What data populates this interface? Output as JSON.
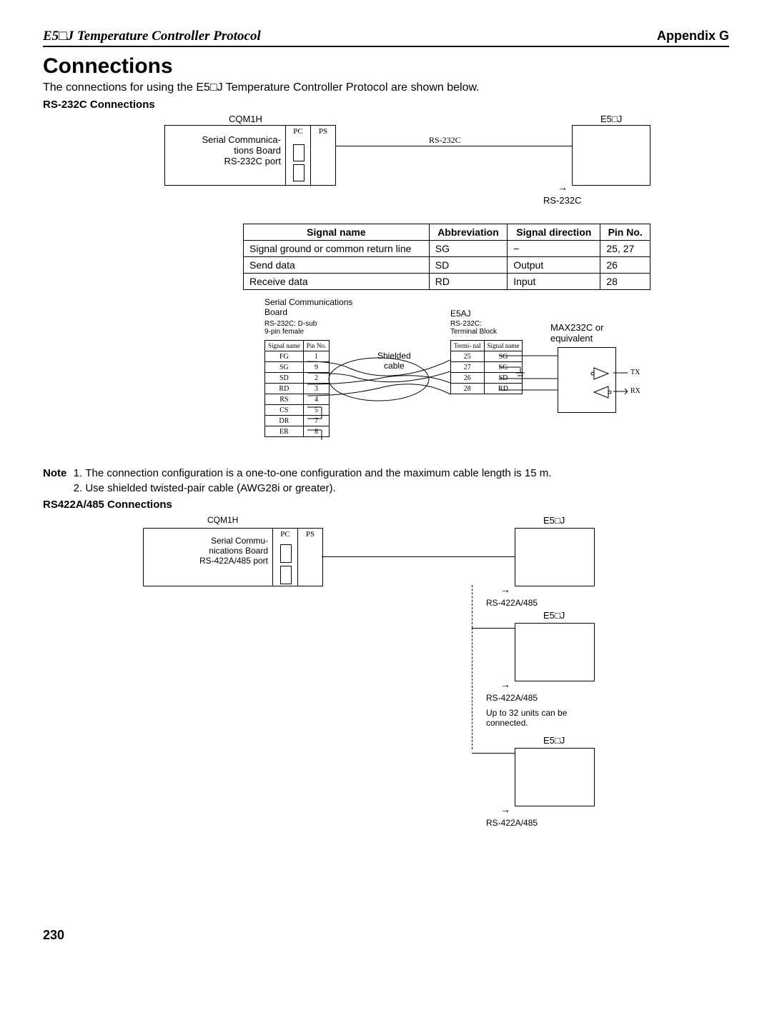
{
  "header": {
    "left": "E5□J Temperature Controller Protocol",
    "right": "Appendix G"
  },
  "title": "Connections",
  "intro": "The connections for using the E5□J Temperature Controller Protocol are shown below.",
  "rs232": {
    "heading": "RS-232C Connections",
    "cqm1h": "CQM1H",
    "board": "Serial Communica-\ntions Board\nRS-232C port",
    "pc": "PC",
    "ps": "PS",
    "rs232c": "RS-232C",
    "e5j": "E5□J",
    "rs232c_under": "RS-232C"
  },
  "table": {
    "headers": [
      "Signal name",
      "Abbreviation",
      "Signal direction",
      "Pin No."
    ],
    "rows": [
      [
        "Signal ground or common return line",
        "SG",
        "−",
        "25, 27"
      ],
      [
        "Send data",
        "SD",
        "Output",
        "26"
      ],
      [
        "Receive data",
        "RD",
        "Input",
        "28"
      ]
    ]
  },
  "wiring": {
    "board_label": "Serial Communications\nBoard",
    "dsub": "RS-232C: D-sub\n9-pin female",
    "e5aj": "E5AJ",
    "tb": "RS-232C:\nTerminal Block",
    "shielded": "Shielded\ncable",
    "max": "MAX232C or\nequivalent",
    "tx": "TX",
    "rx": "RX",
    "left_cols": [
      "Signal\nname",
      "Pin\nNo."
    ],
    "left_pins": [
      [
        "FG",
        "1"
      ],
      [
        "SG",
        "9"
      ],
      [
        "SD",
        "2"
      ],
      [
        "RD",
        "3"
      ],
      [
        "RS",
        "4"
      ],
      [
        "CS",
        "5"
      ],
      [
        "DR",
        "7"
      ],
      [
        "ER",
        "8"
      ]
    ],
    "right_cols": [
      "Termi-\nnal",
      "Signal\nname"
    ],
    "right_pins": [
      [
        "25",
        "SG"
      ],
      [
        "27",
        "SG"
      ],
      [
        "26",
        "SD"
      ],
      [
        "28",
        "RD"
      ]
    ]
  },
  "notes": {
    "label": "Note",
    "items": [
      "The connection configuration is a one-to-one configuration and the maximum cable length is 15 m.",
      "Use shielded twisted-pair cable (AWG28i or greater)."
    ]
  },
  "rs485": {
    "heading": "RS422A/485 Connections",
    "cqm1h": "CQM1H",
    "board": "Serial Commu-\nnications Board\nRS-422A/485 port",
    "pc": "PC",
    "ps": "PS",
    "e5j": "E5□J",
    "rs": "RS-422A/485",
    "up_to": "Up to 32 units can be\nconnected."
  },
  "page": "230"
}
